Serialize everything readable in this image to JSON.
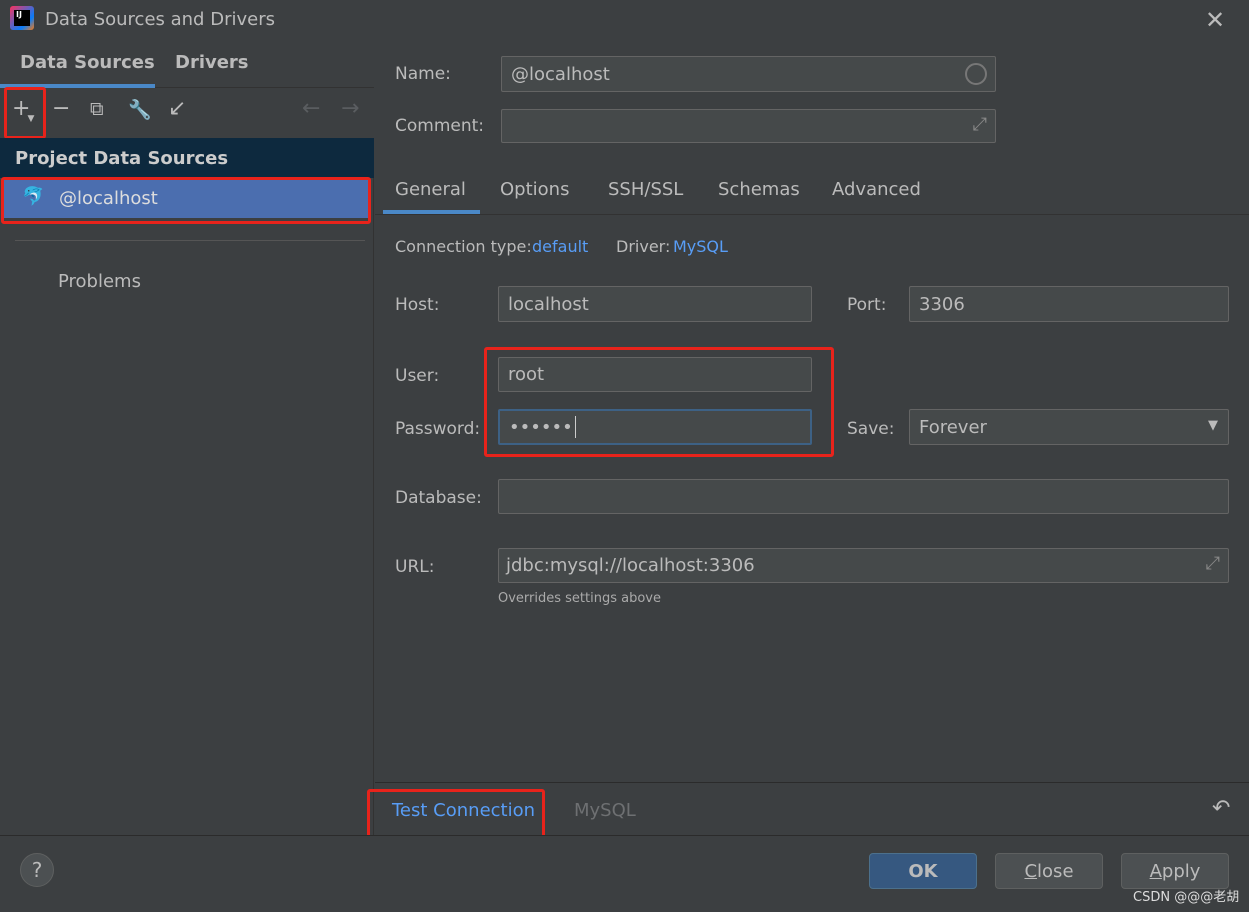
{
  "window": {
    "title": "Data Sources and Drivers",
    "logo_text": "IJ"
  },
  "left": {
    "tabs": [
      {
        "label": "Data Sources",
        "active": true
      },
      {
        "label": "Drivers",
        "active": false
      }
    ],
    "toolbar": [
      "add-icon",
      "remove-icon",
      "duplicate-icon",
      "wrench-icon",
      "import-icon",
      "back-icon",
      "forward-icon"
    ],
    "section_title": "Project Data Sources",
    "items": [
      {
        "label": "@localhost",
        "selected": true,
        "icon": "mysql-dolphin-icon"
      }
    ],
    "problems": "Problems"
  },
  "form": {
    "name_label": "Name:",
    "name_value": "@localhost",
    "comment_label": "Comment:",
    "comment_value": "",
    "tabs": [
      "General",
      "Options",
      "SSH/SSL",
      "Schemas",
      "Advanced"
    ],
    "active_tab": "General",
    "connection_type_label": "Connection type:",
    "connection_type": "default",
    "driver_label": "Driver:",
    "driver": "MySQL",
    "host_label": "Host:",
    "host": "localhost",
    "port_label": "Port:",
    "port": "3306",
    "user_label": "User:",
    "user": "root",
    "password_label": "Password:",
    "password": "••••••",
    "save_label": "Save:",
    "save": "Forever",
    "database_label": "Database:",
    "database": "",
    "url_label": "URL:",
    "url": "jdbc:mysql://localhost:3306",
    "url_hint": "Overrides settings above"
  },
  "bottom": {
    "test_connection": "Test Connection",
    "driver_name": "MySQL"
  },
  "footer": {
    "help": "?",
    "ok": "OK",
    "close_u": "C",
    "close_rest": "lose",
    "apply_u": "A",
    "apply_rest": "pply",
    "watermark": "CSDN @@@老胡"
  },
  "colors": {
    "accent": "#4a88c7",
    "link": "#589df6",
    "selection": "#4b6eaf",
    "highlight": "#e8231b"
  }
}
